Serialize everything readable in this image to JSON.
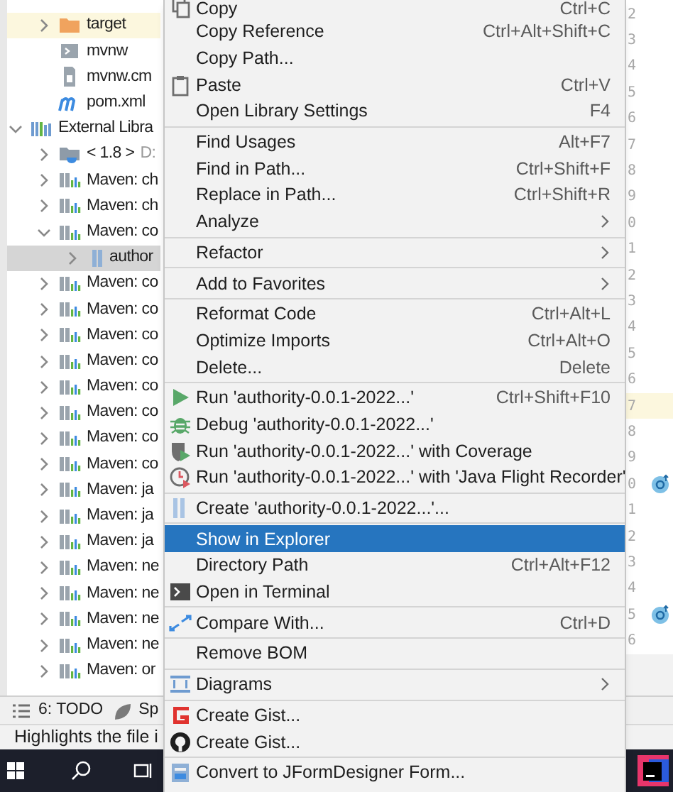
{
  "tree": [
    {
      "kind": "group",
      "children": [
        {
          "label": "target",
          "kind": "folder",
          "expanded": false,
          "selected": false,
          "highlighted": true
        },
        {
          "label": "mvnw",
          "kind": "script",
          "selected": false,
          "highlighted": false
        },
        {
          "label": "mvnw.cm",
          "kind": "cmd-file",
          "selected": false,
          "highlighted": false
        },
        {
          "label": "pom.xml",
          "kind": "pom",
          "selected": false,
          "highlighted": false
        }
      ]
    },
    {
      "label": "External Libra",
      "kind": "libraries",
      "expanded": true,
      "selected": false,
      "highlighted": false,
      "children": [
        {
          "label": "< 1.8 >",
          "detail": "D:",
          "kind": "jdk",
          "expanded": false,
          "selected": false,
          "highlighted": false
        },
        {
          "label": "Maven: ch",
          "kind": "library",
          "expanded": false,
          "selected": false,
          "highlighted": false
        },
        {
          "label": "Maven: ch",
          "kind": "library",
          "expanded": false,
          "selected": false,
          "highlighted": false
        },
        {
          "label": "Maven: co",
          "kind": "library",
          "expanded": true,
          "selected": false,
          "highlighted": false,
          "children": [
            {
              "label": "author",
              "kind": "jar",
              "expanded": false,
              "selected": true,
              "highlighted": false
            }
          ]
        },
        {
          "label": "Maven: co",
          "kind": "library",
          "expanded": false,
          "selected": false,
          "highlighted": false
        },
        {
          "label": "Maven: co",
          "kind": "library",
          "expanded": false,
          "selected": false,
          "highlighted": false
        },
        {
          "label": "Maven: co",
          "kind": "library",
          "expanded": false,
          "selected": false,
          "highlighted": false
        },
        {
          "label": "Maven: co",
          "kind": "library",
          "expanded": false,
          "selected": false,
          "highlighted": false
        },
        {
          "label": "Maven: co",
          "kind": "library",
          "expanded": false,
          "selected": false,
          "highlighted": false
        },
        {
          "label": "Maven: co",
          "kind": "library",
          "expanded": false,
          "selected": false,
          "highlighted": false
        },
        {
          "label": "Maven: co",
          "kind": "library",
          "expanded": false,
          "selected": false,
          "highlighted": false
        },
        {
          "label": "Maven: co",
          "kind": "library",
          "expanded": false,
          "selected": false,
          "highlighted": false
        },
        {
          "label": "Maven: ja",
          "kind": "library",
          "expanded": false,
          "selected": false,
          "highlighted": false
        },
        {
          "label": "Maven: ja",
          "kind": "library",
          "expanded": false,
          "selected": false,
          "highlighted": false
        },
        {
          "label": "Maven: ja",
          "kind": "library",
          "expanded": false,
          "selected": false,
          "highlighted": false
        },
        {
          "label": "Maven: ne",
          "kind": "library",
          "expanded": false,
          "selected": false,
          "highlighted": false
        },
        {
          "label": "Maven: ne",
          "kind": "library",
          "expanded": false,
          "selected": false,
          "highlighted": false
        },
        {
          "label": "Maven: ne",
          "kind": "library",
          "expanded": false,
          "selected": false,
          "highlighted": false
        },
        {
          "label": "Maven: ne",
          "kind": "library",
          "expanded": false,
          "selected": false,
          "highlighted": false
        },
        {
          "label": "Maven: or",
          "kind": "library",
          "expanded": false,
          "selected": false,
          "highlighted": false
        }
      ]
    }
  ],
  "gutter": [
    {
      "n": "2",
      "current": false,
      "marker": false
    },
    {
      "n": "3",
      "current": false,
      "marker": false
    },
    {
      "n": "4",
      "current": false,
      "marker": false
    },
    {
      "n": "5",
      "current": false,
      "marker": false
    },
    {
      "n": "6",
      "current": false,
      "marker": false
    },
    {
      "n": "7",
      "current": false,
      "marker": false
    },
    {
      "n": "8",
      "current": false,
      "marker": false
    },
    {
      "n": "9",
      "current": false,
      "marker": false
    },
    {
      "n": "0",
      "current": false,
      "marker": false
    },
    {
      "n": "1",
      "current": false,
      "marker": false
    },
    {
      "n": "2",
      "current": false,
      "marker": false
    },
    {
      "n": "3",
      "current": false,
      "marker": false
    },
    {
      "n": "4",
      "current": false,
      "marker": false
    },
    {
      "n": "5",
      "current": false,
      "marker": false
    },
    {
      "n": "6",
      "current": false,
      "marker": false
    },
    {
      "n": "7",
      "current": true,
      "marker": false
    },
    {
      "n": "8",
      "current": false,
      "marker": false
    },
    {
      "n": "9",
      "current": false,
      "marker": false
    },
    {
      "n": "0",
      "current": false,
      "marker": true
    },
    {
      "n": "1",
      "current": false,
      "marker": false
    },
    {
      "n": "2",
      "current": false,
      "marker": false
    },
    {
      "n": "3",
      "current": false,
      "marker": false
    },
    {
      "n": "4",
      "current": false,
      "marker": false
    },
    {
      "n": "5",
      "current": false,
      "marker": true
    },
    {
      "n": "6",
      "current": false,
      "marker": false
    }
  ],
  "context_menu": [
    {
      "kind": "copy",
      "label": "Copy",
      "shortcut": "Ctrl+C",
      "submenu": false,
      "selected": false
    },
    {
      "kind": "plain",
      "label": "Copy Reference",
      "shortcut": "Ctrl+Alt+Shift+C",
      "submenu": false,
      "selected": false
    },
    {
      "kind": "plain",
      "label": "Copy Path...",
      "submenu": false,
      "selected": false
    },
    {
      "kind": "paste",
      "label": "Paste",
      "shortcut": "Ctrl+V",
      "submenu": false,
      "selected": false
    },
    {
      "kind": "plain",
      "label": "Open Library Settings",
      "shortcut": "F4",
      "submenu": false,
      "selected": false
    },
    {
      "kind": "separator"
    },
    {
      "kind": "plain",
      "label": "Find Usages",
      "shortcut": "Alt+F7",
      "submenu": false,
      "selected": false
    },
    {
      "kind": "plain",
      "label": "Find in Path...",
      "shortcut": "Ctrl+Shift+F",
      "submenu": false,
      "selected": false
    },
    {
      "kind": "plain",
      "label": "Replace in Path...",
      "shortcut": "Ctrl+Shift+R",
      "submenu": false,
      "selected": false
    },
    {
      "kind": "plain",
      "label": "Analyze",
      "submenu": true,
      "selected": false
    },
    {
      "kind": "separator"
    },
    {
      "kind": "plain",
      "label": "Refactor",
      "submenu": true,
      "selected": false
    },
    {
      "kind": "separator"
    },
    {
      "kind": "plain",
      "label": "Add to Favorites",
      "submenu": true,
      "selected": false
    },
    {
      "kind": "separator"
    },
    {
      "kind": "plain",
      "label": "Reformat Code",
      "shortcut": "Ctrl+Alt+L",
      "submenu": false,
      "selected": false
    },
    {
      "kind": "plain",
      "label": "Optimize Imports",
      "shortcut": "Ctrl+Alt+O",
      "submenu": false,
      "selected": false
    },
    {
      "kind": "plain",
      "label": "Delete...",
      "shortcut": "Delete",
      "submenu": false,
      "selected": false
    },
    {
      "kind": "separator"
    },
    {
      "kind": "run",
      "label": "Run 'authority-0.0.1-2022...'",
      "shortcut": "Ctrl+Shift+F10",
      "submenu": false,
      "selected": false
    },
    {
      "kind": "debug",
      "label": "Debug 'authority-0.0.1-2022...'",
      "submenu": false,
      "selected": false
    },
    {
      "kind": "coverage",
      "label": "Run 'authority-0.0.1-2022...' with Coverage",
      "submenu": false,
      "selected": false
    },
    {
      "kind": "profiler",
      "label": "Run 'authority-0.0.1-2022...' with 'Java Flight Recorder'",
      "submenu": false,
      "selected": false
    },
    {
      "kind": "separator"
    },
    {
      "kind": "config",
      "label": "Create 'authority-0.0.1-2022...'...",
      "submenu": false,
      "selected": false
    },
    {
      "kind": "separator"
    },
    {
      "kind": "plain",
      "label": "Show in Explorer",
      "submenu": false,
      "selected": true
    },
    {
      "kind": "plain",
      "label": "Directory Path",
      "shortcut": "Ctrl+Alt+F12",
      "submenu": false,
      "selected": false
    },
    {
      "kind": "terminal",
      "label": "Open in Terminal",
      "submenu": false,
      "selected": false
    },
    {
      "kind": "separator"
    },
    {
      "kind": "compare",
      "label": "Compare With...",
      "shortcut": "Ctrl+D",
      "submenu": false,
      "selected": false
    },
    {
      "kind": "separator"
    },
    {
      "kind": "plain",
      "label": "Remove BOM",
      "submenu": false,
      "selected": false
    },
    {
      "kind": "separator"
    },
    {
      "kind": "diagrams",
      "label": "Diagrams",
      "submenu": true,
      "selected": false
    },
    {
      "kind": "separator"
    },
    {
      "kind": "gist",
      "label": "Create Gist...",
      "submenu": false,
      "selected": false
    },
    {
      "kind": "github",
      "label": "Create Gist...",
      "submenu": false,
      "selected": false
    },
    {
      "kind": "separator"
    },
    {
      "kind": "form",
      "label": "Convert to JFormDesigner Form...",
      "submenu": false,
      "selected": false
    }
  ],
  "tool_window_bar": [
    {
      "kind": "todo",
      "label": "6: TODO"
    },
    {
      "kind": "spring",
      "label": "Sp"
    }
  ],
  "status_bar": {
    "text": "Highlights the file i"
  }
}
